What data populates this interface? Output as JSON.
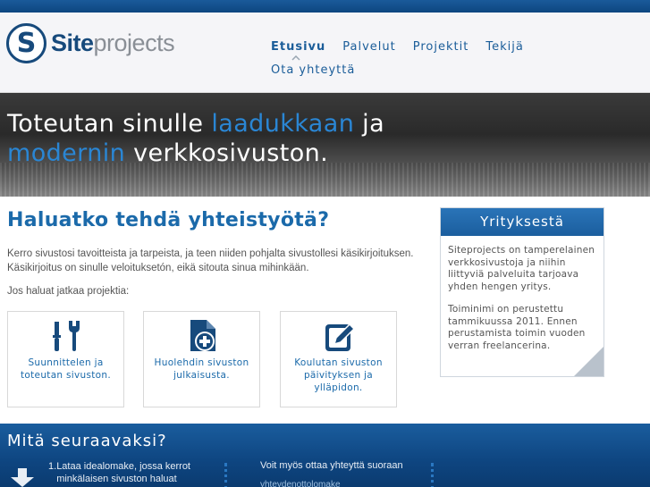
{
  "logo": {
    "mark": "S",
    "word_site": "Site",
    "word_projects": "projects"
  },
  "nav": {
    "items": [
      {
        "label": "Etusivu",
        "active": true
      },
      {
        "label": "Palvelut"
      },
      {
        "label": "Projektit"
      },
      {
        "label": "Tekijä"
      }
    ],
    "second_row": "Ota yhteyttä"
  },
  "hero": {
    "line1_plain": "Toteutan sinulle ",
    "line1_accent": "laadukkaan",
    "line1_end": " ja",
    "line2_accent": "modernin",
    "line2_plain": " verkkosivuston."
  },
  "main": {
    "title": "Haluatko tehdä yhteistyötä?",
    "intro": "Kerro sivustosi tavoitteista ja tarpeista, ja teen niiden pohjalta sivustollesi käsikirjoituksen. Käsikirjoitus on sinulle veloituksetón, eikä sitouta sinua mihinkään.",
    "intro2": "Jos haluat jatkaa projektia:",
    "cards": [
      {
        "icon": "tools-icon",
        "label": "Suunnittelen ja toteutan sivuston."
      },
      {
        "icon": "document-plus-icon",
        "label": "Huolehdin sivuston julkaisusta."
      },
      {
        "icon": "edit-icon",
        "label": "Koulutan sivuston päivityksen ja ylläpidon."
      }
    ]
  },
  "sidebar": {
    "title": "Yrityksestä",
    "p1": "Siteprojects on tamperelainen verkkosivustoja ja niihin liittyviä palveluita tarjoava yhden hengen yritys.",
    "p2": "Toiminimi on perustettu tammikuussa 2011. Ennen perustamista toimin vuoden verran freelancerina."
  },
  "footer": {
    "title": "Mitä seuraavaksi?",
    "step1_num": "1.",
    "step1_text": "Lataa idealomake, jossa kerrot minkälaisen sivuston haluat",
    "contact_text": "Voit myös ottaa yhteyttä suoraan",
    "contact_link": "yhteydenottolomake"
  },
  "colors": {
    "brand_blue": "#1b6aaa",
    "dark_navy": "#174a7c",
    "footer_blue": "#0e4580"
  }
}
